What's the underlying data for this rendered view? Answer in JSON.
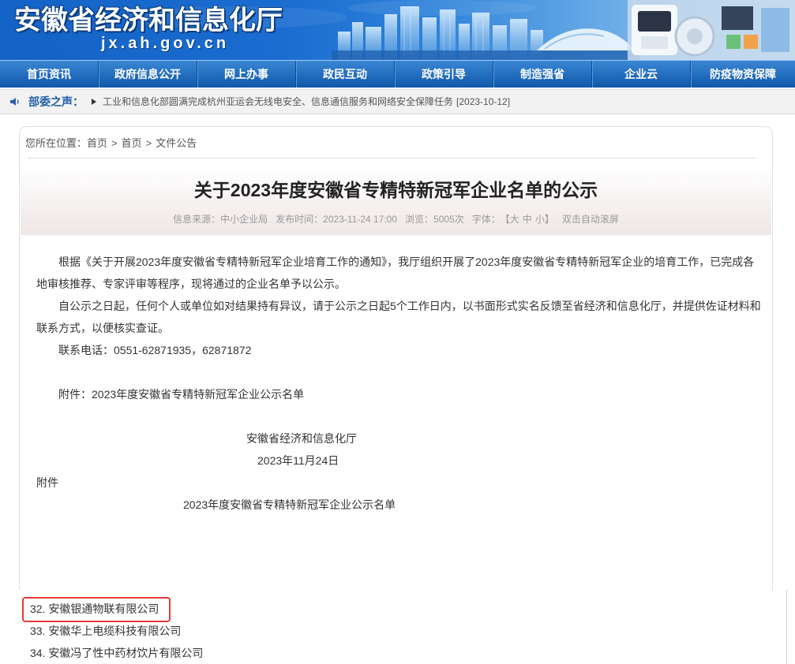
{
  "header": {
    "title": "安徽省经济和信息化厅",
    "domain": "jx.ah.gov.cn"
  },
  "nav": {
    "items": [
      "首页资讯",
      "政府信息公开",
      "网上办事",
      "政民互动",
      "政策引导",
      "制造强省",
      "企业云",
      "防疫物资保障"
    ]
  },
  "ticker": {
    "icon": "speaker-icon",
    "label": "部委之声：",
    "bullet_icon": "triangle-right-icon",
    "headline": "工业和信息化部圆满完成杭州亚运会无线电安全、信息通信服务和网络安全保障任务",
    "date": "[2023-10-12]"
  },
  "breadcrumb": {
    "prefix": "您所在位置：",
    "separator": ">",
    "items": [
      "首页",
      "首页",
      "文件公告"
    ]
  },
  "article": {
    "title": "关于2023年度安徽省专精特新冠军企业名单的公示",
    "meta": {
      "source_label": "信息来源：",
      "source": "中小企业局",
      "published_label": "发布时间：",
      "published": "2023-11-24 17:00",
      "views_label": "浏览：",
      "views": "5005次",
      "font_label": "字体：",
      "font_bracket_open": "【",
      "font_large": "大",
      "font_medium": "中",
      "font_small": "小",
      "font_bracket_close": "】",
      "autoscroll": "双击自动滚屏"
    },
    "paragraphs": [
      "根据《关于开展2023年度安徽省专精特新冠军企业培育工作的通知》，我厅组织开展了2023年度安徽省专精特新冠军企业的培育工作，已完成各地审核推荐、专家评审等程序，现将通过的企业名单予以公示。",
      "自公示之日起，任何个人或单位如对结果持有异议，请于公示之日起5个工作日内，以书面形式实名反馈至省经济和信息化厅，并提供佐证材料和联系方式，以便核实查证。",
      "联系电话：0551-62871935，62871872"
    ],
    "attachment_ref": "附件：2023年度安徽省专精特新冠军企业公示名单",
    "signature": {
      "org": "安徽省经济和信息化厅",
      "date": "2023年11月24日"
    },
    "attachment_heading": "附件",
    "list_title": "2023年度安徽省专精特新冠军企业公示名单",
    "companies": [
      "32. 安徽银通物联有限公司",
      "33. 安徽华上电缆科技有限公司",
      "34. 安徽冯了性中药材饮片有限公司"
    ]
  },
  "colors": {
    "brand_blue": "#1a62b8",
    "nav_top": "#3a86d4",
    "nav_bottom": "#1058aa",
    "label_blue": "#2461a8",
    "highlight_red": "#e53935"
  }
}
